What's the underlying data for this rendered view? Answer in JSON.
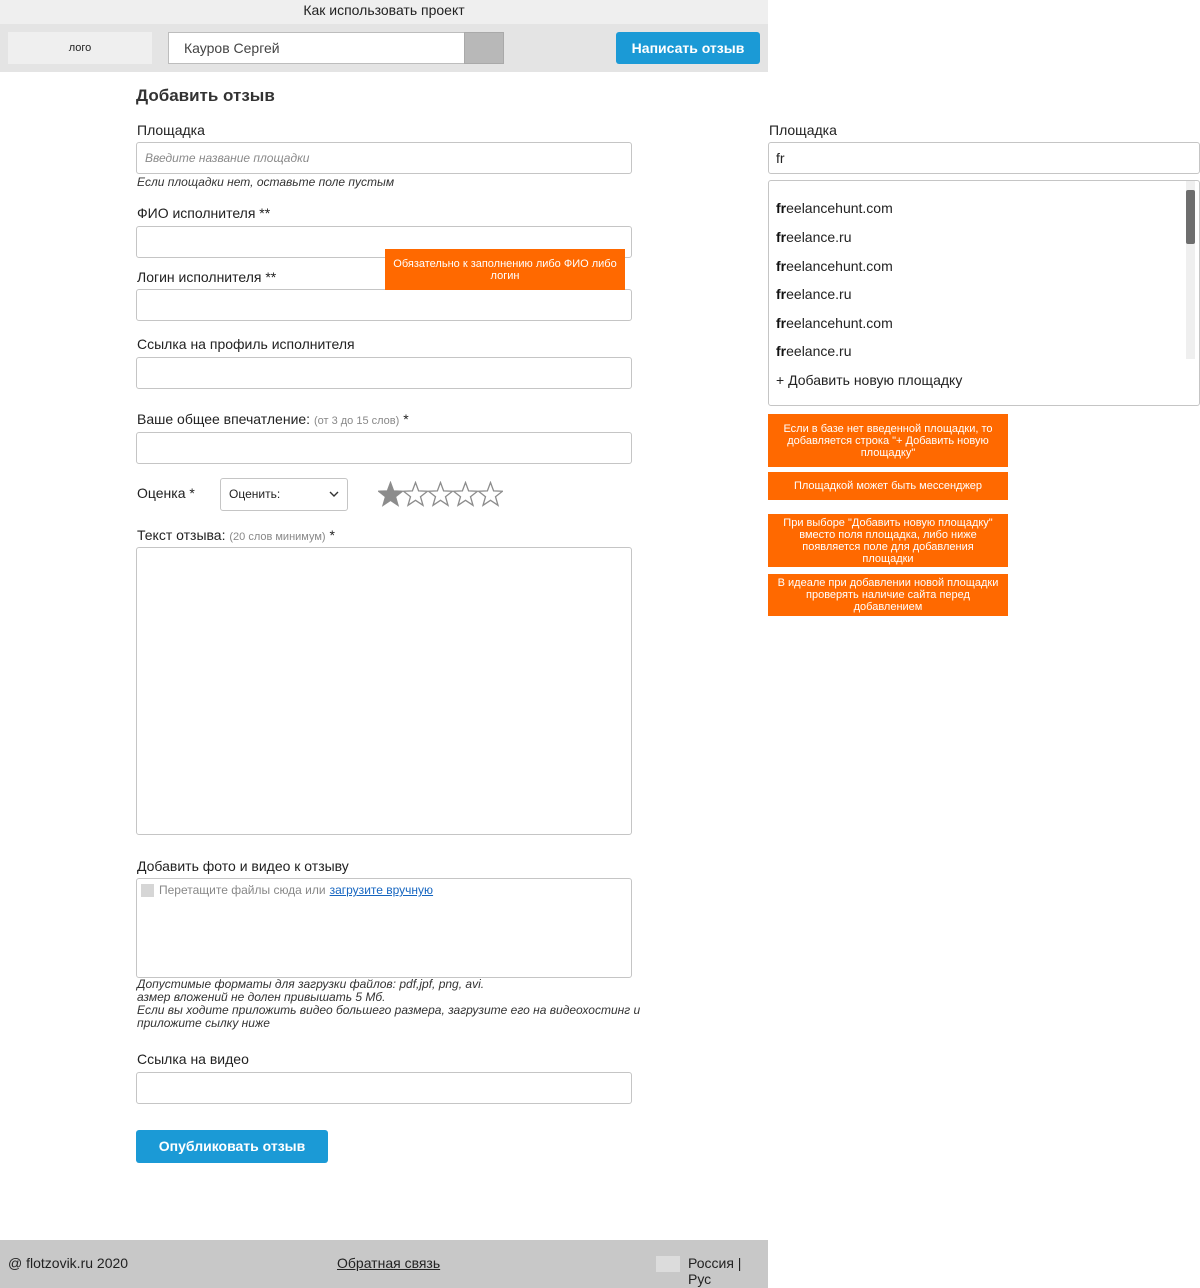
{
  "topbar": {
    "text": "Как использовать проект"
  },
  "header": {
    "logo": "лого",
    "search_value": "Кауров Сергей",
    "write_button": "Написать отзыв"
  },
  "form": {
    "title": "Добавить отзыв",
    "platform": {
      "label": "Площадка",
      "placeholder": "Введите название площадки",
      "hint": "Если площадки нет, оставьте поле пустым"
    },
    "fio_label": "ФИО исполнителя **",
    "login_label": "Логин исполнителя **",
    "profile_link_label": "Ссылка на профиль исполнителя",
    "impression": {
      "label": "Ваше общее впечатление:",
      "sub": "(от 3 до 15 слов)",
      "required": "*"
    },
    "rating": {
      "label": "Оценка *",
      "select_value": "Оценить:",
      "filled": 1,
      "total": 5
    },
    "review_text": {
      "label": "Текст отзыва:",
      "sub": "(20 слов минимум)",
      "required": "*"
    },
    "media": {
      "label": "Добавить фото и видео к отзыву",
      "drop_text": "Перетащите файлы сюда или",
      "drop_link": "загрузите вручную",
      "hint_lines": [
        "Допустимые форматы для загрузки файлов: pdf,jpf, png, avi.",
        "азмер вложений не долен привышать 5 Мб.",
        "Если вы ходите приложить видео большего размера, загрузите его на видеохостинг и",
        "приложите сылку ниже"
      ]
    },
    "video_link_label": "Ссылка на видео",
    "publish_button": "Опубликовать отзыв"
  },
  "notes": {
    "fio_or_login": "Обязательно к заполнению либо ФИО либо логин",
    "add_new_row": "Если в базе нет введенной площадки, то добавляется строка \"+ Добавить новую площадку\"",
    "messenger": "Площадкой может быть мессенджер",
    "new_platform_field": "При выборе \"Добавить новую площадку\" вместо поля площадка, либо ниже появляется поле для добавления площадки",
    "check_site": "В идеале при добавлении новой площадки проверять наличие сайта перед добавлением"
  },
  "autocomplete": {
    "label": "Площадка",
    "value": "fr",
    "match": "fr",
    "items": [
      {
        "rest": "eelancehunt.com"
      },
      {
        "rest": "eelance.ru"
      },
      {
        "rest": "eelancehunt.com"
      },
      {
        "rest": "eelance.ru"
      },
      {
        "rest": "eelancehunt.com"
      },
      {
        "rest": "eelance.ru"
      }
    ],
    "add_new": "+ Добавить новую площадку"
  },
  "footer": {
    "copyright": "@ flotzovik.ru 2020",
    "feedback": "Обратная связь",
    "language": "Россия | Рус"
  },
  "colors": {
    "accent": "#1b9ad6",
    "note": "#ff6900"
  }
}
